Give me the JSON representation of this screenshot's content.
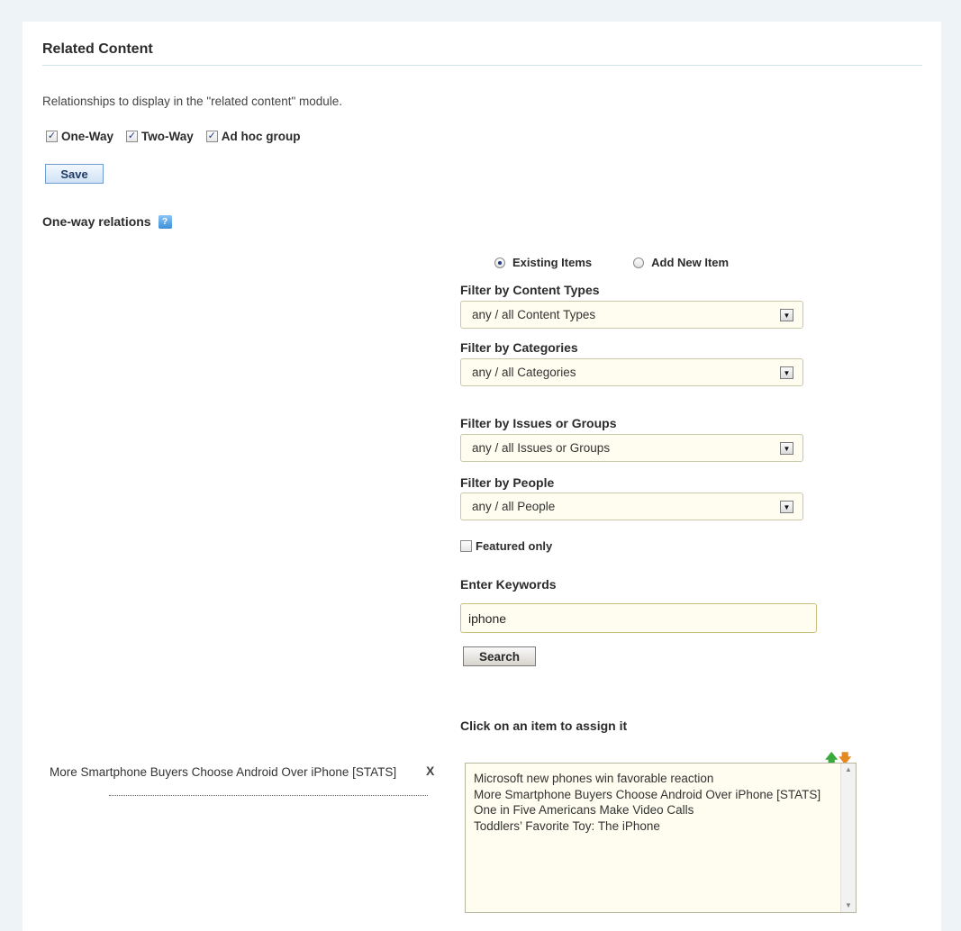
{
  "section": {
    "title": "Related Content",
    "intro": "Relationships to display in the \"related content\" module."
  },
  "relationship_types": [
    {
      "label": "One-Way",
      "checked": true
    },
    {
      "label": "Two-Way",
      "checked": true
    },
    {
      "label": "Ad hoc group",
      "checked": true
    }
  ],
  "save_label": "Save",
  "one_way": {
    "title": "One-way relations",
    "help_icon": "help-icon"
  },
  "mode": {
    "existing_label": "Existing Items",
    "add_new_label": "Add New Item",
    "selected": "Existing Items"
  },
  "filters": {
    "content_types": {
      "label": "Filter by Content Types",
      "value": "any / all Content Types"
    },
    "categories": {
      "label": "Filter by Categories",
      "value": "any / all Categories"
    },
    "issues": {
      "label": "Filter by Issues or Groups",
      "value": "any / all Issues or Groups"
    },
    "people": {
      "label": "Filter by People",
      "value": "any / all People"
    }
  },
  "featured": {
    "label": "Featured only",
    "checked": false
  },
  "keywords": {
    "label": "Enter Keywords",
    "value": "iphone"
  },
  "search_label": "Search",
  "assign": {
    "label": "Click on an item to assign it",
    "results": [
      "Microsoft new phones win favorable reaction",
      "More Smartphone Buyers Choose Android Over iPhone [STATS]",
      "One in Five Americans Make Video Calls",
      "Toddlers’ Favorite Toy: The iPhone"
    ]
  },
  "assigned": {
    "items": [
      {
        "title": "More Smartphone Buyers Choose Android Over iPhone [STATS]",
        "remove_label": "X"
      }
    ]
  },
  "colors": {
    "background": "#eef3f8",
    "field_background": "#fffdef",
    "save_button": "#cfe2f6",
    "help_icon": "#3d8fd8",
    "move_up": "#3aa83a",
    "move_down": "#e58a21"
  }
}
